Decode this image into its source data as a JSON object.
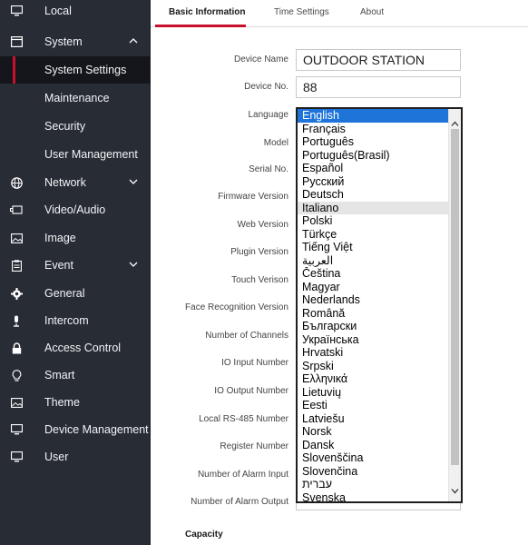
{
  "sidebar": {
    "items": [
      {
        "name": "local",
        "label": "Local",
        "icon": "monitor-icon",
        "top": 0
      },
      {
        "name": "system",
        "label": "System",
        "icon": "window-icon",
        "chevron": "up"
      },
      {
        "name": "system-settings",
        "label": "System Settings",
        "sub": true,
        "active": true
      },
      {
        "name": "maintenance",
        "label": "Maintenance",
        "sub": true
      },
      {
        "name": "security",
        "label": "Security",
        "sub": true
      },
      {
        "name": "user-management",
        "label": "User Management",
        "sub": true
      },
      {
        "name": "network",
        "label": "Network",
        "icon": "globe-icon",
        "chevron": "down"
      },
      {
        "name": "video-audio",
        "label": "Video/Audio",
        "icon": "camera-icon"
      },
      {
        "name": "image",
        "label": "Image",
        "icon": "image-icon"
      },
      {
        "name": "event",
        "label": "Event",
        "icon": "clipboard-icon",
        "chevron": "down"
      },
      {
        "name": "general",
        "label": "General",
        "icon": "gear-icon"
      },
      {
        "name": "intercom",
        "label": "Intercom",
        "icon": "microphone-icon"
      },
      {
        "name": "access-control",
        "label": "Access Control",
        "icon": "lock-icon"
      },
      {
        "name": "smart",
        "label": "Smart",
        "icon": "bulb-icon"
      },
      {
        "name": "theme",
        "label": "Theme",
        "icon": "image-icon"
      },
      {
        "name": "device-management",
        "label": "Device Management",
        "icon": "monitor-icon"
      },
      {
        "name": "user",
        "label": "User",
        "icon": "monitor-icon"
      }
    ]
  },
  "tabs": [
    {
      "label": "Basic Information",
      "active": true
    },
    {
      "label": "Time Settings",
      "active": false
    },
    {
      "label": "About",
      "active": false
    }
  ],
  "form": {
    "device_name_label": "Device Name",
    "device_name_value": "OUTDOOR STATION",
    "device_no_label": "Device No.",
    "device_no_value": "88",
    "language_label": "Language",
    "model_label": "Model",
    "serial_label": "Serial No.",
    "firmware_label": "Firmware Version",
    "web_label": "Web Version",
    "plugin_label": "Plugin Version",
    "touch_label": "Touch Verison",
    "face_label": "Face Recognition Version",
    "channels_label": "Number of Channels",
    "io_input_label": "IO Input Number",
    "io_output_label": "IO Output Number",
    "rs485_label": "Local RS-485 Number",
    "register_label": "Register Number",
    "alarm_input_label": "Number of Alarm Input",
    "alarm_output_label": "Number of Alarm Output"
  },
  "language_options": [
    "English",
    "Français",
    "Português",
    "Português(Brasil)",
    "Español",
    "Русский",
    "Deutsch",
    "Italiano",
    "Polski",
    "Türkçe",
    "Tiếng Việt",
    "العربية",
    "Čeština",
    "Magyar",
    "Nederlands",
    "Română",
    "Български",
    "Українська",
    "Hrvatski",
    "Srpski",
    "Ελληνικά",
    "Lietuvių",
    "Eesti",
    "Latviešu",
    "Norsk",
    "Dansk",
    "Slovenščina",
    "Slovenčina",
    "עברית",
    "Svenska"
  ],
  "language_selected": "English",
  "language_hovered": "Italiano",
  "capacity_title": "Capacity",
  "colors": {
    "sidebar_bg": "#282c35",
    "accent": "#c8102e",
    "selected_option": "#1e74d8"
  }
}
